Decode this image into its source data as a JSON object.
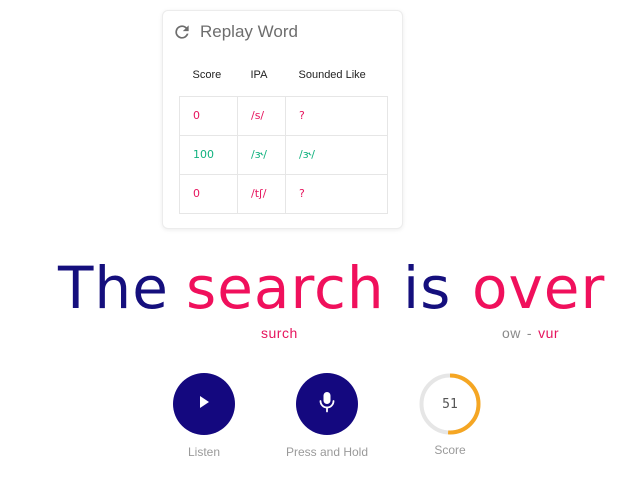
{
  "replay": {
    "label": "Replay Word",
    "icon": "refresh-icon"
  },
  "table": {
    "headers": [
      "Score",
      "IPA",
      "Sounded Like"
    ],
    "rows": [
      {
        "score": "0",
        "ipa": "/s/",
        "sounded": "?",
        "status": "bad"
      },
      {
        "score": "100",
        "ipa": "/ɝ/",
        "sounded": "/ɝ/",
        "status": "good"
      },
      {
        "score": "0",
        "ipa": "/tʃ/",
        "sounded": "?",
        "status": "bad"
      }
    ]
  },
  "sentence": {
    "words": [
      "The",
      "search",
      "is",
      "over"
    ],
    "hints": {
      "search": "surch",
      "over": {
        "ok": "ow",
        "sep": "-",
        "bad": "vur"
      }
    }
  },
  "controls": {
    "listen": {
      "label": "Listen",
      "icon": "play-icon"
    },
    "record": {
      "label": "Press and Hold",
      "icon": "microphone-icon"
    },
    "score": {
      "label": "Score",
      "value": "51",
      "fraction": 0.51
    }
  },
  "colors": {
    "navy": "#14087f",
    "pink": "#f0105c",
    "green": "#12b27f",
    "orange": "#f5a623",
    "gray": "#9a9a9a"
  }
}
